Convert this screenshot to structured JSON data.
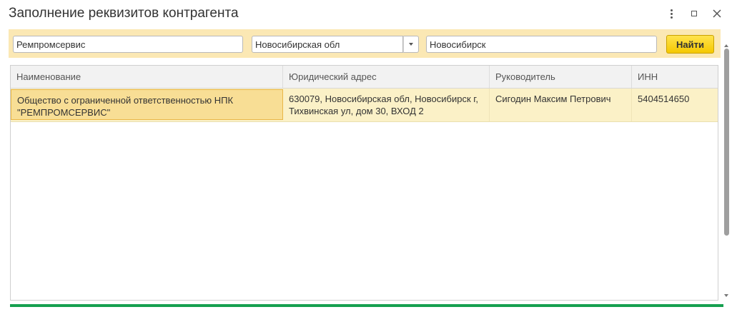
{
  "window": {
    "title": "Заполнение реквизитов контрагента",
    "icons": [
      "more-vertical-icon",
      "maximize-icon",
      "close-icon"
    ]
  },
  "search": {
    "name_value": "Ремпромсервис",
    "region_value": "Новосибирская обл",
    "city_value": "Новосибирск",
    "find_label": "Найти",
    "accent_color": "#f5c800",
    "bar_color": "#fbe8b4"
  },
  "table": {
    "columns": [
      "Наименование",
      "Юридический адрес",
      "Руководитель",
      "ИНН"
    ],
    "rows": [
      {
        "name": "Общество с ограниченной ответственностью НПК \"РЕМПРОМСЕРВИС\"",
        "address": "630079, Новосибирская обл, Новосибирск г, Тихвинская ул, дом 30, ВХОД 2",
        "director": "Сигодин Максим Петрович",
        "inn": "5404514650"
      }
    ],
    "selected_row_color": "#fbf1c7"
  },
  "status": {
    "progress_color": "#16a050"
  }
}
